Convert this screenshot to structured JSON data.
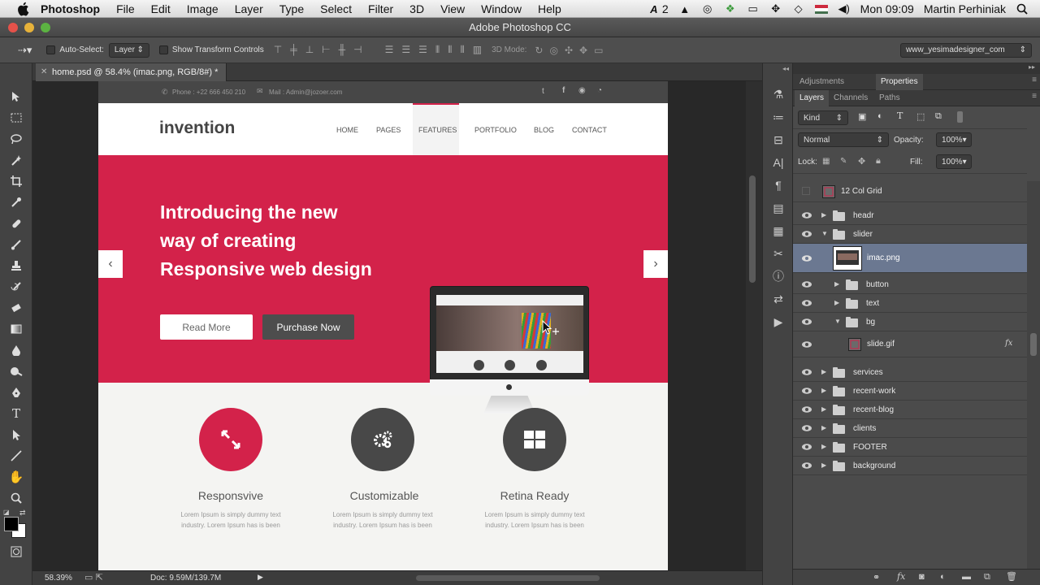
{
  "menubar": {
    "items": [
      "Photoshop",
      "File",
      "Edit",
      "Image",
      "Layer",
      "Type",
      "Select",
      "Filter",
      "3D",
      "View",
      "Window",
      "Help"
    ],
    "adobe_count": "2",
    "clock": "Mon 09:09",
    "user": "Martin Perhiniak"
  },
  "window": {
    "title": "Adobe Photoshop CC"
  },
  "options": {
    "auto_select_label": "Auto-Select:",
    "auto_select_value": "Layer",
    "show_transform_label": "Show Transform Controls",
    "mode_3d_label": "3D Mode:",
    "workspace": "www_yesimadesigner_com"
  },
  "doc_tab": {
    "title": "home.psd @ 58.4% (imac.png, RGB/8#) *"
  },
  "status": {
    "zoom": "58.39%",
    "doc_size": "Doc: 9.59M/139.7M"
  },
  "website": {
    "phone": "Phone : +22 666 450 210",
    "mail": "Mail : Admin@jozoer.com",
    "logo": "invention",
    "nav": [
      "HOME",
      "PAGES",
      "FEATURES",
      "PORTFOLIO",
      "BLOG",
      "CONTACT"
    ],
    "hero_line1": "Introducing the new",
    "hero_line2": "way of creating",
    "hero_line3": "Responsive web design",
    "btn_read_more": "Read More",
    "btn_purchase": "Purchase Now",
    "features": [
      {
        "title": "Responsvive",
        "text1": "Lorem Ipsum is simply dummy text",
        "text2": "industry. Lorem Ipsum has is been"
      },
      {
        "title": "Customizable",
        "text1": "Lorem Ipsum is simply dummy text",
        "text2": "industry. Lorem Ipsum has is been"
      },
      {
        "title": "Retina Ready",
        "text1": "Lorem Ipsum is simply dummy text",
        "text2": "industry. Lorem Ipsum has is been"
      }
    ],
    "brand_color": "#d3224a"
  },
  "panels": {
    "top_tabs": [
      "Adjustments",
      "Properties"
    ],
    "layer_tabs": [
      "Layers",
      "Channels",
      "Paths"
    ],
    "filter_kind": "Kind",
    "blend_mode": "Normal",
    "opacity_label": "Opacity:",
    "opacity_value": "100%",
    "lock_label": "Lock:",
    "fill_label": "Fill:",
    "fill_value": "100%",
    "fx_label": "fx",
    "layers": [
      {
        "name": "12 Col Grid"
      },
      {
        "name": "headr"
      },
      {
        "name": "slider"
      },
      {
        "name": "imac.png"
      },
      {
        "name": "button"
      },
      {
        "name": "text"
      },
      {
        "name": "bg"
      },
      {
        "name": "slide.gif"
      },
      {
        "name": "services"
      },
      {
        "name": "recent-work"
      },
      {
        "name": "recent-blog"
      },
      {
        "name": "clients"
      },
      {
        "name": "FOOTER"
      },
      {
        "name": "background"
      }
    ]
  }
}
